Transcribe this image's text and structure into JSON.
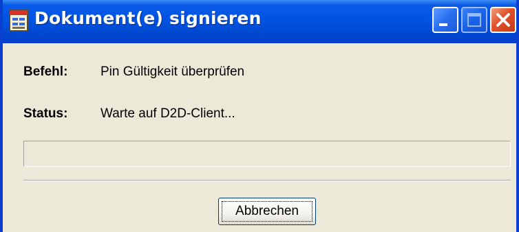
{
  "window": {
    "title": "Dokument(e) signieren",
    "icon": "document-form-icon",
    "controls": [
      "minimize-icon",
      "maximize-icon",
      "close-icon"
    ]
  },
  "fields": {
    "command_label": "Befehl:",
    "command_value": "Pin Gültigkeit überprüfen",
    "status_label": "Status:",
    "status_value": "Warte auf D2D-Client..."
  },
  "progress": {
    "fraction": 0
  },
  "buttons": {
    "cancel_label": "Abbrechen"
  },
  "colors": {
    "titlebar": "#0054e3",
    "window_bg": "#ece9d8",
    "close_button": "#e0502a"
  }
}
